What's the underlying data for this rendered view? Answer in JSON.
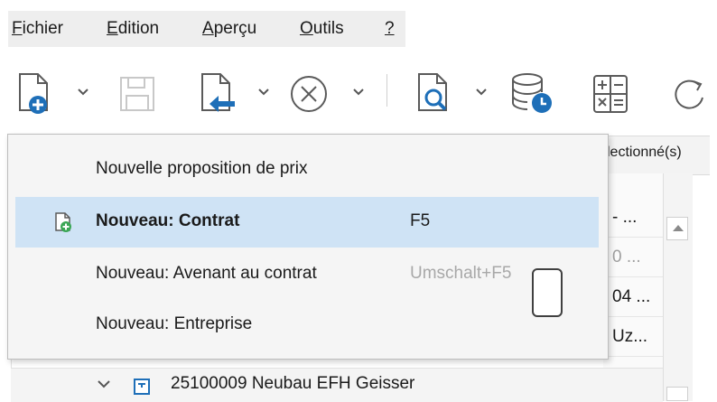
{
  "menubar": {
    "items": [
      {
        "first": "F",
        "rest": "ichier"
      },
      {
        "first": "E",
        "rest": "dition"
      },
      {
        "first": "A",
        "rest": "perçu"
      },
      {
        "first": "O",
        "rest": "utils"
      },
      {
        "first": "?",
        "rest": ""
      }
    ]
  },
  "toolbar": {
    "icons": [
      "new-document-icon",
      "save-icon",
      "import-document-icon",
      "cancel-circle-icon",
      "search-document-icon",
      "database-clock-icon",
      "calculator-icon",
      "refresh-icon"
    ]
  },
  "background": {
    "header_text": "lectionné(s)",
    "rows": [
      "- ...",
      "0 ...",
      "04 ...",
      "Uz..."
    ],
    "tree_item": "25100009 Neubau EFH Geisser"
  },
  "popup": {
    "items": [
      {
        "label": "Nouvelle proposition de prix",
        "shortcut": "",
        "selected": false,
        "disabled_shortcut": false
      },
      {
        "label": "Nouveau: Contrat",
        "shortcut": "F5",
        "selected": true,
        "disabled_shortcut": false
      },
      {
        "label": "Nouveau: Avenant au contrat",
        "shortcut": "Umschalt+F5",
        "selected": false,
        "disabled_shortcut": true
      },
      {
        "label": "Nouveau: Entreprise",
        "shortcut": "",
        "selected": false,
        "disabled_shortcut": false
      }
    ]
  },
  "colors": {
    "accent": "#1e88c8",
    "selection": "#cfe3f5",
    "green": "#3aa655"
  }
}
